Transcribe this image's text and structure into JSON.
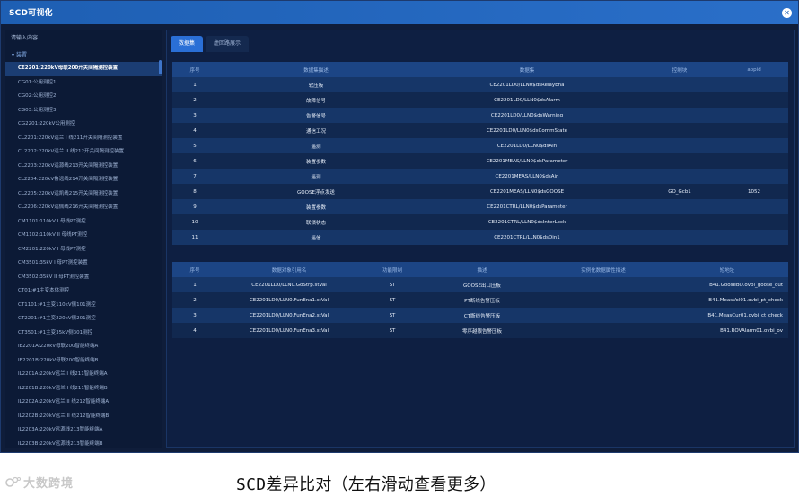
{
  "window": {
    "title": "SCD可视化",
    "close_icon": "close-icon"
  },
  "sidebar": {
    "search_placeholder": "请输入内容",
    "root_label": "装置",
    "items": [
      "CE2201:220kV母联200开关间隔测控装置",
      "CG01:公用测控1",
      "CG02:公用测控2",
      "CG03:公用测控3",
      "CG2201:220kV公用测控",
      "CL2201:220kV远兰 I 线211开关间隔测控装置",
      "CL2202:220kV远兰 II 线212开关间隔测控装置",
      "CL2203:220kV远源线213开关间隔测控装置",
      "CL2204:220kV鲁远线214开关间隔测控装置",
      "CL2205:220kV远凯线215开关间隔测控装置",
      "CL2206:220kV远佩线216开关间隔测控装置",
      "CM1101:110kV I 母线PT测控",
      "CM1102:110kV II 母线PT测控",
      "CM2201:220kV I 母线PT测控",
      "CM3501:35kV I 母PT测控装置",
      "CM3502:35kV II 母PT测控装置",
      "CT01:#1主变本体测控",
      "CT1101:#1主变110kV侧101测控",
      "CT2201:#1主变220kV侧201测控",
      "CT3501:#1主变35kV侧301测控",
      "IE2201A:220kV母联200智能终端A",
      "IE2201B:220kV母联200智能终端B",
      "IL2201A:220kV远兰 I 线211智能终端A",
      "IL2201B:220kV远兰 I 线211智能终端B",
      "IL2202A:220kV远兰 II 线212智能终端A",
      "IL2202B:220kV远兰 II 线212智能终端B",
      "IL2203A:220kV远源线213智能终端A",
      "IL2203B:220kV远源线213智能终端B"
    ],
    "selected_index": 0
  },
  "tabs": [
    {
      "label": "数据集",
      "active": true
    },
    {
      "label": "虚回路展示",
      "active": false
    }
  ],
  "dataset_table": {
    "headers": [
      "序号",
      "数据集描述",
      "数据集",
      "控制块",
      "appid"
    ],
    "rows": [
      [
        "1",
        "软压板",
        "CE2201LD0/LLN0$dsRelayEna",
        "",
        ""
      ],
      [
        "2",
        "故障信号",
        "CE2201LD0/LLN0$dsAlarm",
        "",
        ""
      ],
      [
        "3",
        "告警信号",
        "CE2201LD0/LLN0$dsWarning",
        "",
        ""
      ],
      [
        "4",
        "通信工况",
        "CE2201LD0/LLN0$dsCommState",
        "",
        ""
      ],
      [
        "5",
        "遥测",
        "CE2201LD0/LLN0$dsAin",
        "",
        ""
      ],
      [
        "6",
        "装置参数",
        "CE2201MEAS/LLN0$dsParameter",
        "",
        ""
      ],
      [
        "7",
        "遥测",
        "CE2201MEAS/LLN0$dsAin",
        "",
        ""
      ],
      [
        "8",
        "GOOSE浮点发送",
        "CE2201MEAS/LLN0$dsGOOSE",
        "GO_Gcb1",
        "1052"
      ],
      [
        "9",
        "装置参数",
        "CE2201CTRL/LLN0$dsParameter",
        "",
        ""
      ],
      [
        "10",
        "联锁状态",
        "CE2201CTRL/LLN0$dsInterLock",
        "",
        ""
      ],
      [
        "11",
        "遥信",
        "CE2201CTRL/LLN0$dsDin1",
        "",
        ""
      ]
    ]
  },
  "reference_table": {
    "headers": [
      "序号",
      "数据对象引用名",
      "功能限制",
      "描述",
      "实例化数据属性描述",
      "短地址"
    ],
    "rows": [
      [
        "1",
        "CE2201LD0/LLN0.GoStrp.stVal",
        "ST",
        "GOOSE出口压板",
        "",
        "B41.GooseBO.ovbi_goose_out"
      ],
      [
        "2",
        "CE2201LD0/LLN0.FunEna1.stVal",
        "ST",
        "PT断线告警压板",
        "",
        "B41.MeasVol01.ovbi_pt_check"
      ],
      [
        "3",
        "CE2201LD0/LLN0.FunEna2.stVal",
        "ST",
        "CT断线告警压板",
        "",
        "B41.MeasCur01.ovbi_ct_check"
      ],
      [
        "4",
        "CE2201LD0/LLN0.FunEna3.stVal",
        "ST",
        "零序越限告警压板",
        "",
        "B41.ROVAlarm01.ovbi_ov"
      ]
    ]
  },
  "footer": {
    "logo_text": "大数跨境",
    "caption": "SCD差异比对（左右滑动查看更多）"
  },
  "colors": {
    "titlebar": "#2a6fc9",
    "tab_active": "#2a6fd6",
    "header_row": "#1c4585",
    "row_odd": "#163668",
    "row_even": "#11284f",
    "sidebar_selected": "#1b3d73"
  }
}
